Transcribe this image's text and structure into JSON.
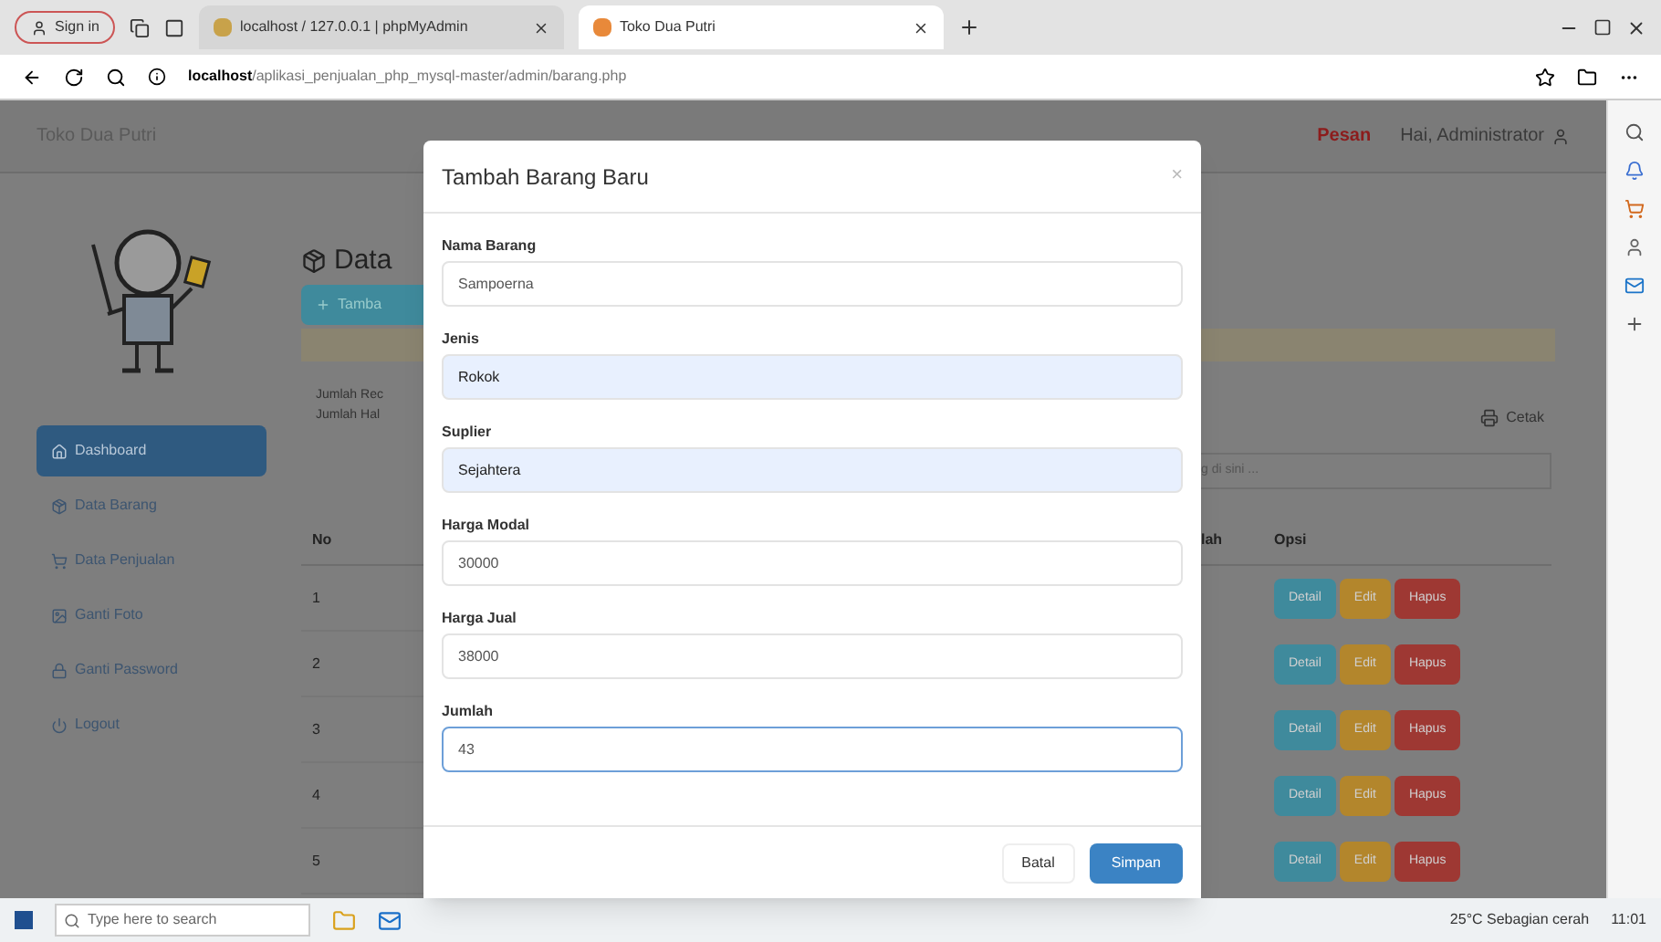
{
  "browser": {
    "profile": "Sign in",
    "tabs": [
      {
        "title": "localhost / 127.0.0.1 | phpMyAdmin",
        "selected": false
      },
      {
        "title": "Toko Dua Putri",
        "selected": true
      }
    ],
    "url_host": "localhost",
    "url_path": "/aplikasi_penjualan_php_mysql-master/admin/barang.php"
  },
  "navbar": {
    "brand": "Toko Dua Putri",
    "badge": "Pesan",
    "user": "Hai, Administrator"
  },
  "sidebar": {
    "items": [
      {
        "label": "Dashboard",
        "selected": true
      },
      {
        "label": "Data Barang",
        "selected": false
      },
      {
        "label": "Data Penjualan",
        "selected": false
      },
      {
        "label": "Ganti Foto",
        "selected": false
      },
      {
        "label": "Ganti Password",
        "selected": false
      },
      {
        "label": "Logout",
        "selected": false
      }
    ]
  },
  "main": {
    "heading": "Data",
    "add_button": "Tamba",
    "info": [
      "Jumlah Rec",
      "Jumlah Hal"
    ],
    "print_button": "Cetak",
    "search_placeholder": "g di sini ...",
    "columns_left": [
      "No"
    ],
    "columns_right": [
      "lah",
      "Opsi"
    ],
    "rows": [
      {
        "no": "1",
        "actions": [
          "Detail",
          "Edit",
          "Hapus"
        ]
      },
      {
        "no": "2",
        "actions": [
          "Detail",
          "Edit",
          "Hapus"
        ]
      },
      {
        "no": "3",
        "actions": [
          "Detail",
          "Edit",
          "Hapus"
        ]
      },
      {
        "no": "4",
        "actions": [
          "Detail",
          "Edit",
          "Hapus"
        ]
      },
      {
        "no": "5",
        "actions": [
          "Detail",
          "Edit",
          "Hapus"
        ]
      }
    ]
  },
  "modal": {
    "title": "Tambah Barang Baru",
    "close": "×",
    "fields": [
      {
        "label": "Nama Barang",
        "value": "Sampoerna",
        "autofilled": false,
        "focused": false
      },
      {
        "label": "Jenis",
        "value": "Rokok",
        "autofilled": true,
        "focused": false
      },
      {
        "label": "Suplier",
        "value": "Sejahtera",
        "autofilled": true,
        "focused": false
      },
      {
        "label": "Harga Modal",
        "value": "30000",
        "autofilled": false,
        "focused": false
      },
      {
        "label": "Harga Jual",
        "value": "38000",
        "autofilled": false,
        "focused": false
      },
      {
        "label": "Jumlah",
        "value": "43",
        "autofilled": false,
        "focused": true
      }
    ],
    "cancel": "Batal",
    "save": "Simpan"
  },
  "taskbar": {
    "search_placeholder": "Type here to search",
    "weather": "25°C Sebagian cerah",
    "time": "11:01"
  }
}
